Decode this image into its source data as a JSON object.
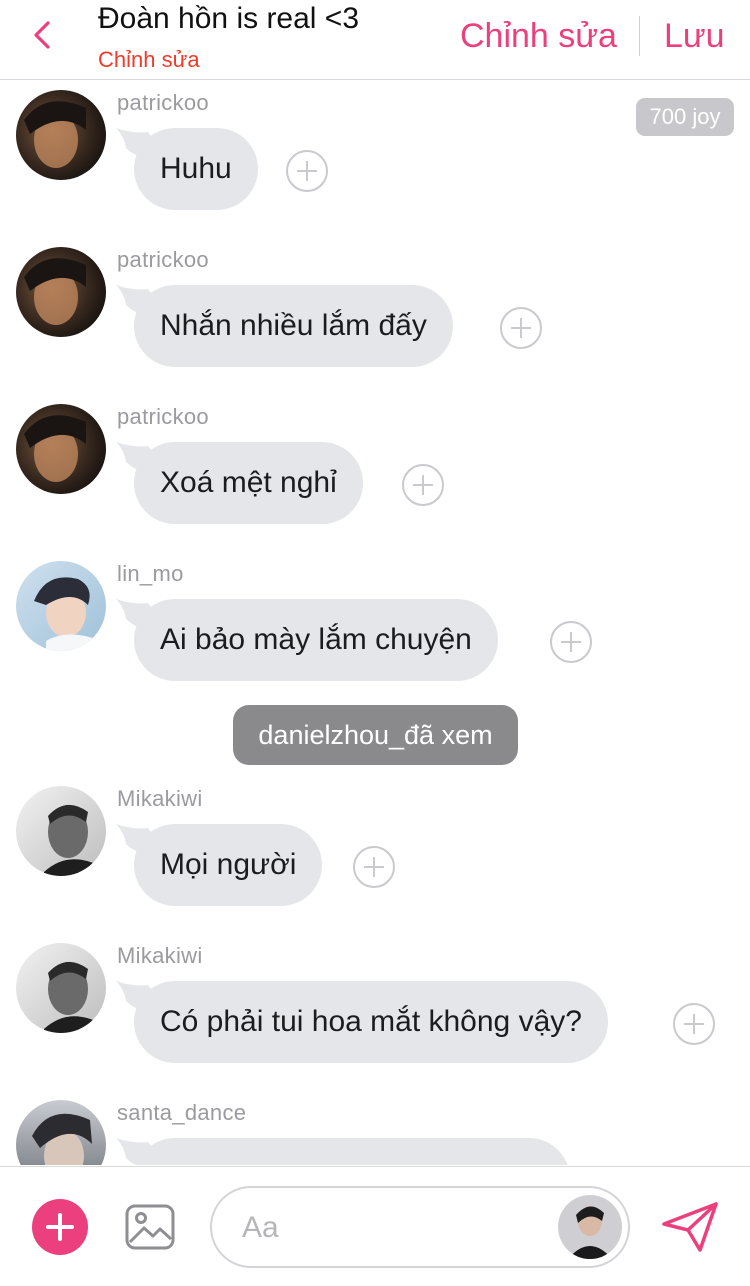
{
  "header": {
    "back_icon": "chevron-left-icon",
    "title": "Đoàn hồn is real <3",
    "subtitle": "Chỉnh sửa",
    "edit_label": "Chỉnh sửa",
    "save_label": "Lưu",
    "accent_color": "#ec3f7d",
    "subtitle_color": "#ef3b2c"
  },
  "messages": [
    {
      "username": "patrickoo",
      "text": "Huhu",
      "badge": "700 joy"
    },
    {
      "username": "patrickoo",
      "text": "Nhắn nhiều lắm đấy"
    },
    {
      "username": "patrickoo",
      "text": "Xoá mệt nghỉ"
    },
    {
      "username": "lin_mo",
      "text": "Ai bảo mày lắm chuyện"
    },
    {
      "username": "Mikakiwi",
      "text": "Mọi người"
    },
    {
      "username": "Mikakiwi",
      "text": "Có phải tui hoa mắt không vậy?"
    },
    {
      "username": "santa_dance",
      "text": ""
    }
  ],
  "seen_notice": "danielzhou_đã xem",
  "composer": {
    "add_icon": "plus-icon",
    "image_icon": "image-icon",
    "placeholder": "Aa",
    "send_icon": "send-icon"
  },
  "colors": {
    "bubble": "#e4e6ea",
    "badge": "#c8c8cc",
    "seen": "#8a8a8c"
  }
}
